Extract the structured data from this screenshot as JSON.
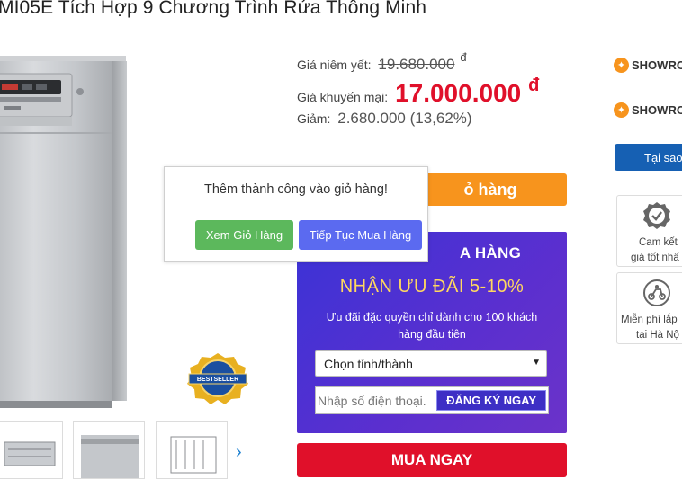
{
  "product": {
    "title": "MI05E Tích Hợp 9 Chương Trình Rửa Thông Minh"
  },
  "pricing": {
    "list_label": "Giá niêm yết:",
    "list_price": "19.680.000",
    "list_currency": "đ",
    "sale_label": "Giá khuyến mại:",
    "sale_price": "17.000.000",
    "sale_currency": "đ",
    "discount_label": "Giảm:",
    "discount_value": "2.680.000 (13,62%)"
  },
  "cart_button": {
    "label": "ỏ hàng"
  },
  "promo": {
    "heading": "A HÀNG",
    "offer": "NHẬN ƯU ĐÃI 5-10%",
    "description": "Ưu đãi đặc quyền chỉ dành cho 100 khách hàng đầu tiên",
    "province_select": "Chọn tỉnh/thành",
    "phone_placeholder": "Nhập số điện thoại.",
    "register_label": "ĐĂNG KÝ NGAY"
  },
  "buy_now": {
    "label": "MUA NGAY"
  },
  "sidebar": {
    "showroom_1": "SHOWRO",
    "showroom_2": "SHOWRO",
    "why_button": "Tại sao",
    "card_1": {
      "line1": "Cam kết",
      "line2": "giá tốt nhấ"
    },
    "card_2": {
      "line1": "Miễn phí lắp",
      "line2": "tại Hà Nộ"
    }
  },
  "badge": {
    "top_text": "BESTSELLER",
    "bottom_text": "BESTSELLER"
  },
  "popup": {
    "message": "Thêm thành công vào giỏ hàng!",
    "view_cart": "Xem Giỏ Hàng",
    "continue_shopping": "Tiếp Tục Mua Hàng"
  },
  "thumbnails": {
    "next_glyph": "›"
  },
  "colors": {
    "sale_red": "#e0102a",
    "orange": "#f7941d",
    "promo_purple": "#4b30d2",
    "popup_green": "#5cb85c",
    "popup_blue": "#5b6af0",
    "brand_blue": "#1660b3"
  },
  "icons": [
    "location-pin-icon",
    "badge-check-icon",
    "free-install-icon",
    "chevron-right-icon",
    "dropdown-caret-icon"
  ]
}
